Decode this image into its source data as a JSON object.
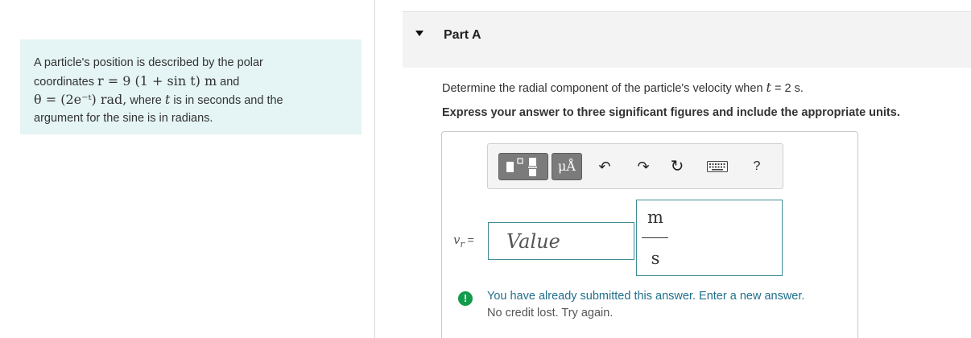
{
  "problem": {
    "line1": "A particle's position is described by the polar",
    "line2_text": "coordinates",
    "line2_math": "r = 9 (1 + sin t) m",
    "line2_end": "and",
    "line3_math": "θ = (2e⁻ᵗ) rad,",
    "line3_mid": "where",
    "line3_var": "t",
    "line3_end": "is in seconds and the",
    "line4": "argument for the sine is in radians."
  },
  "part": {
    "title": "Part A"
  },
  "question": {
    "text": "Determine the radial component of the particle's velocity when",
    "var": "t",
    "value": " = 2 s."
  },
  "instruction": "Express your answer to three significant figures and include the appropriate units.",
  "toolbar": {
    "templates_icon": "templates-icon",
    "units_label": "μÅ",
    "undo_icon": "↶",
    "redo_icon": "↷",
    "reset_icon": "↻",
    "keyboard_icon": "keyboard-icon",
    "help_label": "?"
  },
  "answer": {
    "var_label": "v",
    "var_sub": "r",
    "equals": "=",
    "placeholder": "Value",
    "unit_numerator": "m",
    "unit_denominator": "s"
  },
  "feedback": {
    "icon": "!",
    "line1": "You have already submitted this answer. Enter a new answer.",
    "line2": "No credit lost. Try again."
  },
  "colors": {
    "panel_bg": "#e5f4f4",
    "input_border": "#3f8c94",
    "alert_green": "#119b4a",
    "feedback_text": "#1f6f8b"
  }
}
